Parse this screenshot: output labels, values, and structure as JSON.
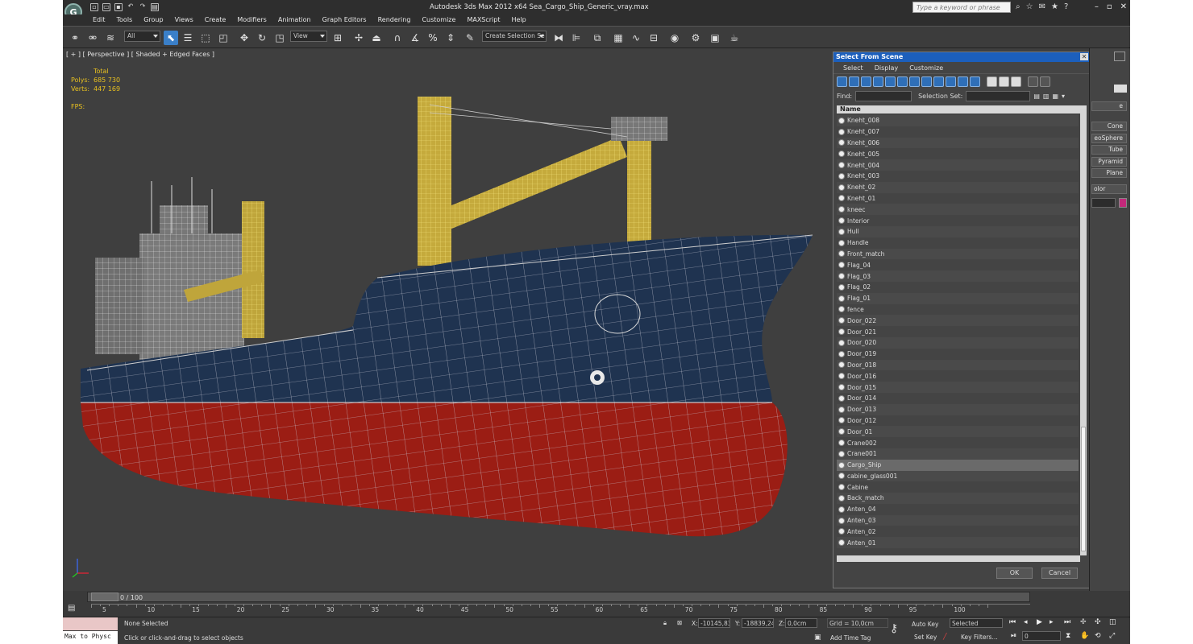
{
  "title": "Autodesk 3ds Max  2012 x64     Sea_Cargo_Ship_Generic_vray.max",
  "search_placeholder": "Type a keyword or phrase",
  "menu": [
    "Edit",
    "Tools",
    "Group",
    "Views",
    "Create",
    "Modifiers",
    "Animation",
    "Graph Editors",
    "Rendering",
    "Customize",
    "MAXScript",
    "Help"
  ],
  "toolbar": {
    "filter": "All",
    "ref_coord": "View",
    "selection_set": "Create Selection Se"
  },
  "viewport": {
    "label": "[ + ] [ Perspective ] [ Shaded + Edged Faces ]",
    "stats_header": "Total",
    "polys_label": "Polys:",
    "polys": "685 730",
    "verts_label": "Verts:",
    "verts": "447 169",
    "fps_label": "FPS:"
  },
  "dialog": {
    "title": "Select From Scene",
    "menu": [
      "Select",
      "Display",
      "Customize"
    ],
    "find_label": "Find:",
    "selection_set_label": "Selection Set:",
    "column_name": "Name",
    "objects": [
      "Kneht_008",
      "Kneht_007",
      "Kneht_006",
      "Kneht_005",
      "Kneht_004",
      "Kneht_003",
      "Kneht_02",
      "Kneht_01",
      "kneec",
      "Interior",
      "Hull",
      "Handle",
      "Front_match",
      "Flag_04",
      "Flag_03",
      "Flag_02",
      "Flag_01",
      "fence",
      "Door_022",
      "Door_021",
      "Door_020",
      "Door_019",
      "Door_018",
      "Door_016",
      "Door_015",
      "Door_014",
      "Door_013",
      "Door_012",
      "Door_01",
      "Crane002",
      "Crane001",
      "Cargo_Ship",
      "cabine_glass001",
      "Cabine",
      "Back_match",
      "Anten_04",
      "Anten_03",
      "Anten_02",
      "Anten_01"
    ],
    "selected": "Cargo_Ship",
    "ok": "OK",
    "cancel": "Cancel"
  },
  "command_panel": {
    "partial": "e",
    "buttons": [
      "Cone",
      "eoSphere",
      "Tube",
      "Pyramid",
      "Plane"
    ],
    "color_label": "olor",
    "color_swatch": "#c2287a"
  },
  "timeline": {
    "position": "0 / 100",
    "ticks": [
      "5",
      "10",
      "15",
      "20",
      "25",
      "30",
      "35",
      "40",
      "45",
      "50",
      "55",
      "60",
      "65",
      "70",
      "75",
      "80",
      "85",
      "90",
      "95",
      "100"
    ]
  },
  "status": {
    "maxscript_prompt": "Max to Physc",
    "selection": "None Selected",
    "prompt": "Click or click-and-drag to select objects",
    "x_label": "X:",
    "x": "-10145,836",
    "y_label": "Y:",
    "y": "-18839,246",
    "z_label": "Z:",
    "z": "0,0cm",
    "grid": "Grid = 10,0cm",
    "add_time_tag": "Add Time Tag",
    "auto_key": "Auto Key",
    "set_key": "Set Key",
    "key_mode": "Selected",
    "key_filters": "Key Filters...",
    "frame": "0"
  }
}
